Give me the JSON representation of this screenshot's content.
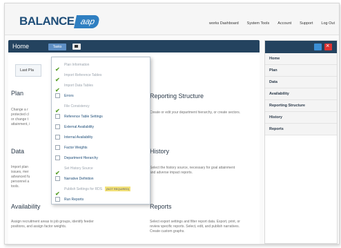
{
  "app": {
    "logo_text": "BALANCE",
    "logo_badge": "aap"
  },
  "topnav": [
    "works Dashboard",
    "System Tools",
    "Account",
    "Support",
    "Log Out"
  ],
  "mainbar": {
    "home_label": "Home",
    "tasks_tab": "Tasks"
  },
  "lastp_label": "Last Pla",
  "sections": [
    {
      "title": "Plan",
      "text": [
        "Change a r",
        "protected cl",
        "or change t",
        "attainment, i"
      ]
    },
    {
      "title": "Reporting Structure",
      "text": [
        "Create or edit your department hierarchy, or create sectors."
      ]
    },
    {
      "title": "Data",
      "text": [
        "Import plan",
        "issues, mer",
        "advanced fu",
        "personnel a",
        "tools."
      ]
    },
    {
      "title": "History",
      "text": [
        "Select the history source, necessary for goal attainment",
        "and adverse impact reports."
      ]
    },
    {
      "title": "Availability",
      "text": [
        "Assign recruitment areas to job groups, identify feeder",
        "positions, and assign factor weights."
      ]
    },
    {
      "title": "Reports",
      "text": [
        "Select export settings and filter report data. Export, print, or",
        "review specific reports. Select, edit, and publish narratives.",
        "Create custom graphs."
      ]
    }
  ],
  "tasks": [
    {
      "label": "Plan Information",
      "done": true,
      "badge": ""
    },
    {
      "label": "Import Reference Tables",
      "done": true,
      "badge": ""
    },
    {
      "label": "Import Data Tables",
      "done": true,
      "badge": ""
    },
    {
      "label": "Errors",
      "done": false,
      "badge": ""
    },
    {
      "label": "File Consistency",
      "done": true,
      "badge": ""
    },
    {
      "label": "Reference Table Settings",
      "done": false,
      "badge": ""
    },
    {
      "label": "External Availability",
      "done": false,
      "badge": ""
    },
    {
      "label": "Internal Availability",
      "done": false,
      "badge": ""
    },
    {
      "label": "Factor Weights",
      "done": false,
      "badge": ""
    },
    {
      "label": "Department Hierarchy",
      "done": false,
      "badge": ""
    },
    {
      "label": "Set History Source",
      "done": true,
      "badge": ""
    },
    {
      "label": "Narrative Definition",
      "done": false,
      "badge": ""
    },
    {
      "label": "Publish Settings for RDS",
      "done": true,
      "badge": "(NOT REQUIRED)"
    },
    {
      "label": "Run Reports",
      "done": false,
      "badge": ""
    }
  ],
  "sidebar": [
    "Home",
    "Plan",
    "Data",
    "Availability",
    "Reporting Structure",
    "History",
    "Reports"
  ],
  "colors": {
    "brand": "#1f4e79",
    "bar": "#24435f",
    "tab": "#5f90c6",
    "check": "#5aa02c",
    "badge": "#f3e27a"
  }
}
